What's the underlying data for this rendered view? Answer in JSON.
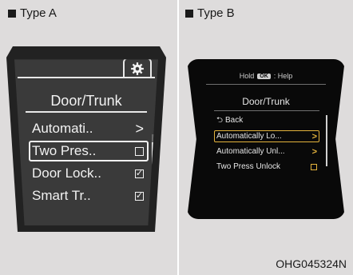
{
  "type_a": {
    "label": "Type A",
    "icon": "gear-icon",
    "title": "Door/Trunk",
    "items": [
      {
        "label": "Automati..",
        "control": "arrow",
        "glyph": ">",
        "selected": false
      },
      {
        "label": "Two Pres..",
        "control": "checkbox",
        "glyph": "",
        "selected": true
      },
      {
        "label": "Door Lock..",
        "control": "checkbox",
        "glyph": "✓",
        "selected": false
      },
      {
        "label": "Smart Tr..",
        "control": "checkbox",
        "glyph": "✓",
        "selected": false
      }
    ]
  },
  "type_b": {
    "label": "Type B",
    "help": {
      "prefix": "Hold",
      "key": "OK",
      "suffix": ": Help"
    },
    "title": "Door/Trunk",
    "items": [
      {
        "label": "Back",
        "glyph_left": "⮌",
        "control": "none",
        "selected": false
      },
      {
        "label": "Automatically Lo...",
        "control": "arrow",
        "glyph": ">",
        "selected": true
      },
      {
        "label": "Automatically Unl...",
        "control": "arrow",
        "glyph": ">",
        "selected": false
      },
      {
        "label": "Two Press Unlock",
        "control": "checkbox",
        "glyph": "",
        "selected": false
      }
    ],
    "accent_color": "#e3b23c"
  },
  "caption": "OHG045324N"
}
